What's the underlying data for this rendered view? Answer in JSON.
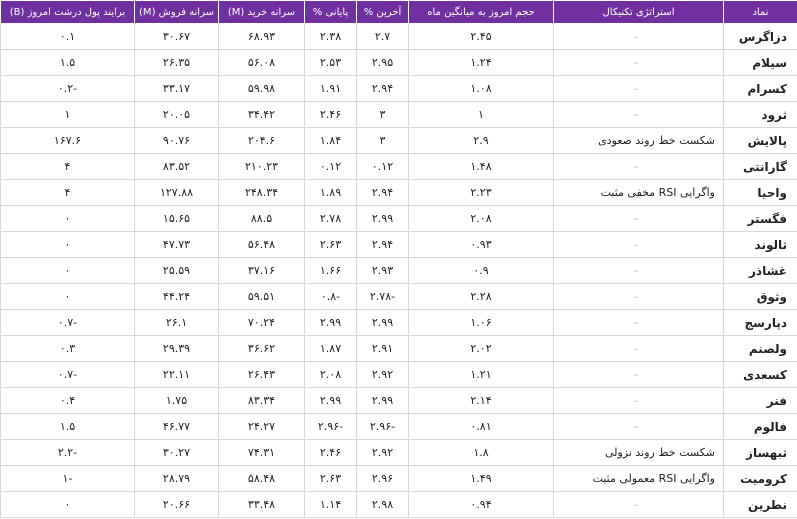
{
  "headers": {
    "symbol": "نماد",
    "strategy": "استراتژی تکنیکال",
    "volume_ratio": "حجم امروز به میانگین ماه",
    "last": "آخرین %",
    "close": "پایانی %",
    "buy_per_capita": "سرانه خرید (M)",
    "sell_per_capita": "سرانه فروش (M)",
    "net_money": "برایند پول درشت امروز (B)"
  },
  "rows": [
    {
      "symbol": "دزاگرس",
      "strategy": "–",
      "volume_ratio": "۲.۴۵",
      "last": "۲.۷",
      "close": "۲.۳۸",
      "buy": "۶۸.۹۳",
      "sell": "۳۰.۶۷",
      "net": "۰.۱"
    },
    {
      "symbol": "سیلام",
      "strategy": "–",
      "volume_ratio": "۱.۲۴",
      "last": "۲.۹۵",
      "close": "۲.۵۳",
      "buy": "۵۶.۰۸",
      "sell": "۲۶.۳۵",
      "net": "۱.۵"
    },
    {
      "symbol": "کسرام",
      "strategy": "–",
      "volume_ratio": "۱.۰۸",
      "last": "۲.۹۴",
      "close": "۱.۹۱",
      "buy": "۵۹.۹۸",
      "sell": "۳۳.۱۷",
      "net": "-۰.۲"
    },
    {
      "symbol": "ثرود",
      "strategy": "–",
      "volume_ratio": "۱",
      "last": "۳",
      "close": "۲.۴۶",
      "buy": "۳۴.۴۲",
      "sell": "۲۰.۰۵",
      "net": "۱"
    },
    {
      "symbol": "پالایش",
      "strategy": "شکست خط روند صعودی",
      "volume_ratio": "۲.۹",
      "last": "۳",
      "close": "۱.۸۴",
      "buy": "۲۰۴.۶",
      "sell": "۹۰.۷۶",
      "net": "۱۶۷.۶"
    },
    {
      "symbol": "گارانتی",
      "strategy": "–",
      "volume_ratio": "۱.۴۸",
      "last": "۰.۱۲",
      "close": "۰.۱۲",
      "buy": "۲۱۰.۲۳",
      "sell": "۸۳.۵۲",
      "net": "۴"
    },
    {
      "symbol": "واحیا",
      "strategy": "واگرایی RSI مخفی مثبت",
      "volume_ratio": "۲.۲۳",
      "last": "۲.۹۴",
      "close": "۱.۸۹",
      "buy": "۲۴۸.۳۴",
      "sell": "۱۲۷.۸۸",
      "net": "۴"
    },
    {
      "symbol": "فگستر",
      "strategy": "–",
      "volume_ratio": "۲.۰۸",
      "last": "۲.۹۹",
      "close": "۲.۷۸",
      "buy": "۸۸.۵",
      "sell": "۱۵.۶۵",
      "net": "۰"
    },
    {
      "symbol": "ثالوند",
      "strategy": "–",
      "volume_ratio": "۰.۹۳",
      "last": "۲.۹۴",
      "close": "۲.۶۳",
      "buy": "۵۶.۴۸",
      "sell": "۴۷.۷۳",
      "net": "۰"
    },
    {
      "symbol": "غشاذر",
      "strategy": "–",
      "volume_ratio": "۰.۹",
      "last": "۲.۹۳",
      "close": "۱.۶۶",
      "buy": "۳۷.۱۶",
      "sell": "۲۵.۵۹",
      "net": "۰"
    },
    {
      "symbol": "وثوق",
      "strategy": "–",
      "volume_ratio": "۲.۲۸",
      "last": "-۲.۷۸",
      "close": "-۰.۸",
      "buy": "۵۹.۵۱",
      "sell": "۴۴.۲۴",
      "net": "۰"
    },
    {
      "symbol": "دپارسج",
      "strategy": "–",
      "volume_ratio": "۱.۰۶",
      "last": "۲.۹۹",
      "close": "۲.۹۹",
      "buy": "۷۰.۲۴",
      "sell": "۲۶.۱",
      "net": "-۰.۷"
    },
    {
      "symbol": "ولصنم",
      "strategy": "–",
      "volume_ratio": "۲.۰۲",
      "last": "۲.۹۱",
      "close": "۱.۸۷",
      "buy": "۳۶.۶۲",
      "sell": "۲۹.۳۹",
      "net": "۰.۳"
    },
    {
      "symbol": "کسعدی",
      "strategy": "–",
      "volume_ratio": "۱.۲۱",
      "last": "۲.۹۲",
      "close": "۲.۰۸",
      "buy": "۲۶.۴۳",
      "sell": "۲۲.۱۱",
      "net": "-۰.۷"
    },
    {
      "symbol": "فنر",
      "strategy": "–",
      "volume_ratio": "۲.۱۴",
      "last": "۲.۹۹",
      "close": "۲.۹۹",
      "buy": "۸۳.۳۴",
      "sell": "۱.۷۵",
      "net": "۰.۴"
    },
    {
      "symbol": "فالوم",
      "strategy": "–",
      "volume_ratio": "۰.۸۱",
      "last": "-۲.۹۶",
      "close": "-۲.۹۶",
      "buy": "۲۴.۲۷",
      "sell": "۴۶.۷۷",
      "net": "۱.۵"
    },
    {
      "symbol": "ثبهساز",
      "strategy": "شکست خط روند نزولی",
      "volume_ratio": "۱.۸",
      "last": "۲.۹۲",
      "close": "۲.۴۶",
      "buy": "۷۴.۳۱",
      "sell": "۳۰.۲۷",
      "net": "-۲.۲"
    },
    {
      "symbol": "کرومیت",
      "strategy": "واگرایی RSI معمولی مثبت",
      "volume_ratio": "۱.۴۹",
      "last": "۲.۹۶",
      "close": "۲.۶۳",
      "buy": "۵۸.۴۸",
      "sell": "۲۸.۷۹",
      "net": "-۱"
    },
    {
      "symbol": "نطرین",
      "strategy": "–",
      "volume_ratio": "۰.۹۴",
      "last": "۲.۹۸",
      "close": "۱.۱۴",
      "buy": "۳۳.۴۸",
      "sell": "۲۰.۶۶",
      "net": "۰"
    }
  ]
}
